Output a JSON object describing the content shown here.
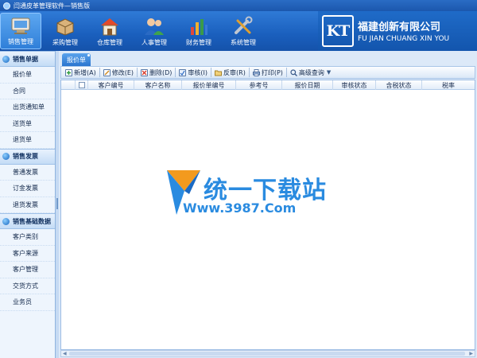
{
  "window": {
    "title": "闫通皮革管理软件—销售版"
  },
  "modules": [
    {
      "label": "销售管理",
      "icon": "sales-icon",
      "active": true
    },
    {
      "label": "采购管理",
      "icon": "purchase-icon",
      "active": false
    },
    {
      "label": "仓库管理",
      "icon": "warehouse-icon",
      "active": false
    },
    {
      "label": "人事管理",
      "icon": "personnel-icon",
      "active": false
    },
    {
      "label": "财务管理",
      "icon": "finance-icon",
      "active": false
    },
    {
      "label": "系统管理",
      "icon": "system-icon",
      "active": false
    }
  ],
  "brand": {
    "logo": "KT",
    "company": "福建创新有限公司",
    "company_en": "FU JIAN CHUANG XIN YOU"
  },
  "sidebar": {
    "groups": [
      {
        "title": "销售单据",
        "items": [
          "报价单",
          "合同",
          "出货通知单",
          "送货单",
          "退货单"
        ]
      },
      {
        "title": "销售发票",
        "items": [
          "普通发票",
          "订金发票",
          "退货发票"
        ]
      },
      {
        "title": "销售基础数据",
        "items": [
          "客户类别",
          "客户来源",
          "客户管理",
          "交货方式",
          "业务员"
        ]
      }
    ]
  },
  "tab": {
    "label": "报价单"
  },
  "toolbar": {
    "new": "新增(A)",
    "edit": "修改(E)",
    "delete": "删除(D)",
    "audit": "审核(I)",
    "unaudit": "反审(R)",
    "print": "打印(P)",
    "search": "高级查询"
  },
  "grid": {
    "columns": [
      "客户编号",
      "客户名称",
      "报价单编号",
      "参考号",
      "报价日期",
      "审核状态",
      "含税状态",
      "税率"
    ]
  },
  "watermark": {
    "text": "统一下载站",
    "url": "Www.3987.Com"
  },
  "colors": {
    "accent": "#1a5fbd",
    "watermark": "#2a8be0"
  }
}
